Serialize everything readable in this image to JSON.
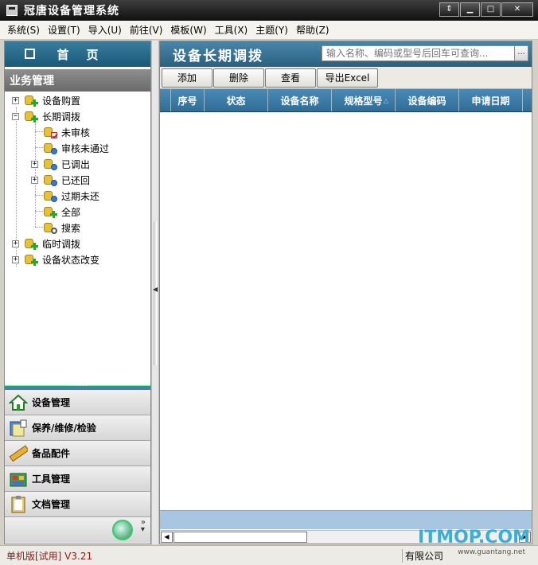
{
  "window": {
    "title": "冠唐设备管理系统",
    "controls": {
      "restore": "⇕",
      "minimize": "▁",
      "maximize": "□",
      "close": "✕"
    }
  },
  "menubar": {
    "items": [
      {
        "label": "系统(S)"
      },
      {
        "label": "设置(T)"
      },
      {
        "label": "导入(U)"
      },
      {
        "label": "前往(V)"
      },
      {
        "label": "模板(W)"
      },
      {
        "label": "工具(X)"
      },
      {
        "label": "主题(Y)"
      },
      {
        "label": "帮助(Z)"
      }
    ]
  },
  "sidebar": {
    "home_label": "首页",
    "section_title": "业务管理",
    "tree": [
      {
        "label": "设备购置",
        "icon": "db-add-icon",
        "expander": "+"
      },
      {
        "label": "长期调拨",
        "icon": "db-add-icon",
        "expander": "−"
      },
      {
        "label": "未审核",
        "icon": "db-check-icon",
        "expander": ""
      },
      {
        "label": "审核未通过",
        "icon": "db-gear-icon",
        "expander": ""
      },
      {
        "label": "已调出",
        "icon": "db-gear-icon",
        "expander": "+"
      },
      {
        "label": "已还回",
        "icon": "db-gear-icon",
        "expander": "+"
      },
      {
        "label": "过期未还",
        "icon": "db-gear-icon",
        "expander": ""
      },
      {
        "label": "全部",
        "icon": "db-add-icon",
        "expander": ""
      },
      {
        "label": "搜索",
        "icon": "db-search-icon",
        "expander": ""
      },
      {
        "label": "临时调拨",
        "icon": "db-add-icon",
        "expander": "+"
      },
      {
        "label": "设备状态改变",
        "icon": "db-add-icon",
        "expander": "+"
      }
    ],
    "nav": [
      {
        "label": "设备管理",
        "icon": "house-icon"
      },
      {
        "label": "保养/维修/检验",
        "icon": "notebook-icon"
      },
      {
        "label": "备品配件",
        "icon": "ruler-icon"
      },
      {
        "label": "工具管理",
        "icon": "toolbox-icon"
      },
      {
        "label": "文档管理",
        "icon": "clipboard-icon"
      }
    ],
    "footer_more": "»\n▾"
  },
  "main": {
    "title": "设备长期调拨",
    "search": {
      "placeholder": "输入名称、编码或型号后回车可查询...",
      "button": "..."
    },
    "toolbar": [
      {
        "label": "添加"
      },
      {
        "label": "删除"
      },
      {
        "label": "查看"
      },
      {
        "label": "导出Excel"
      }
    ],
    "columns": [
      "序号",
      "状态",
      "设备名称",
      "规格型号",
      "设备编码",
      "申请日期"
    ],
    "sort_indicator": "△",
    "rows": []
  },
  "statusbar": {
    "left": "单机版[试用] V3.21",
    "right": "有限公司"
  },
  "watermark": {
    "text": "ITMOP.COM",
    "sub": "www.guantang.net"
  },
  "colors": {
    "titlebar": "#1a1a1a",
    "header_blue": "#2d6d98",
    "status_text": "#8a1a1a",
    "watermark": "#3aaed8"
  }
}
